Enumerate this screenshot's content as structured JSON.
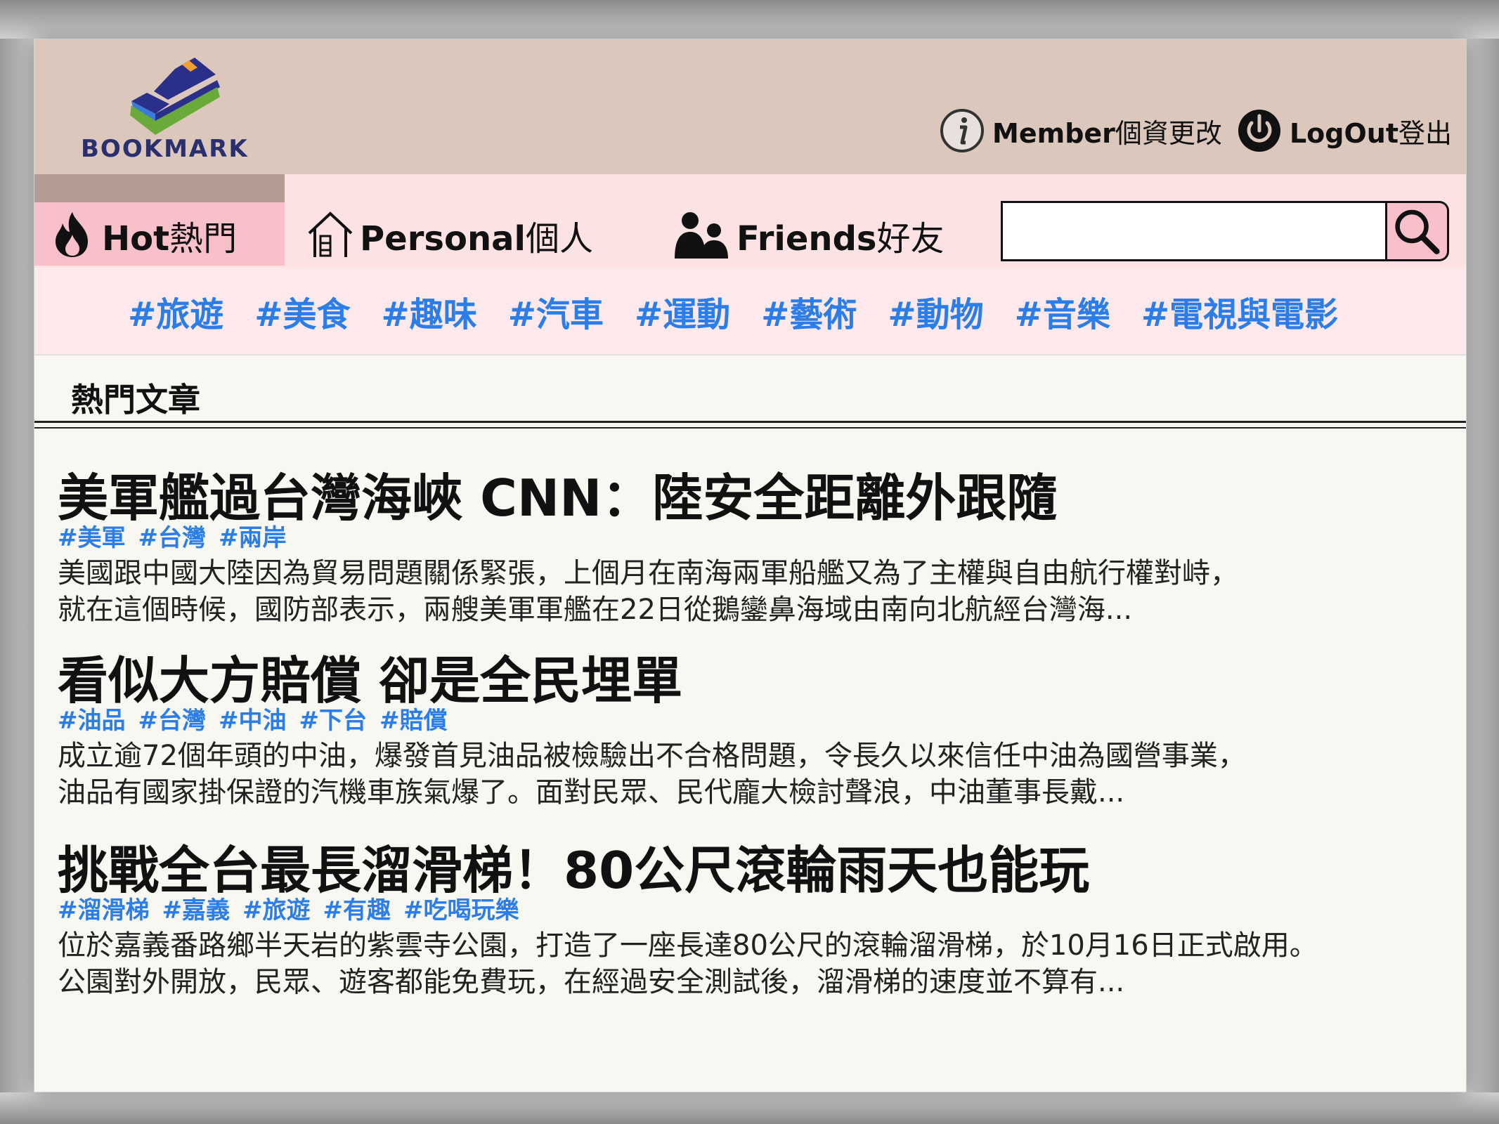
{
  "header": {
    "logo_text": "BOOKMARK",
    "member_en": "Member",
    "member_zh": "個資更改",
    "logout_en": "LogOut",
    "logout_zh": "登出"
  },
  "nav": {
    "tabs": [
      {
        "en": "Hot",
        "zh": "熱門",
        "icon": "flame-icon",
        "active": true
      },
      {
        "en": "Personal",
        "zh": "個人",
        "icon": "house-icon",
        "active": false
      },
      {
        "en": "Friends",
        "zh": "好友",
        "icon": "people-icon",
        "active": false
      }
    ],
    "search": {
      "value": "",
      "placeholder": ""
    }
  },
  "tags": [
    "#旅遊",
    "#美食",
    "#趣味",
    "#汽車",
    "#運動",
    "#藝術",
    "#動物",
    "#音樂",
    "#電視與電影"
  ],
  "section": {
    "title": "熱門文章"
  },
  "articles": [
    {
      "title": "美軍艦過台灣海峽 CNN：陸安全距離外跟隨",
      "tags": [
        "#美軍",
        "#台灣",
        "#兩岸"
      ],
      "summary_line1": "美國跟中國大陸因為貿易問題關係緊張，上個月在南海兩軍船艦又為了主權與自由航行權對峙，",
      "summary_line2": "就在這個時候，國防部表示，兩艘美軍軍艦在22日從鵝鑾鼻海域由南向北航經台灣海..."
    },
    {
      "title": "看似大方賠償 卻是全民埋單",
      "tags": [
        "#油品",
        "#台灣",
        "#中油",
        "#下台",
        "#賠償"
      ],
      "summary_line1": "成立逾72個年頭的中油，爆發首見油品被檢驗出不合格問題，令長久以來信任中油為國營事業，",
      "summary_line2": "油品有國家掛保證的汽機車族氣爆了。面對民眾、民代龐大檢討聲浪，中油董事長戴..."
    },
    {
      "title": "挑戰全台最長溜滑梯！80公尺滾輪雨天也能玩",
      "tags": [
        "#溜滑梯",
        "#嘉義",
        "#旅遊",
        "#有趣",
        "#吃喝玩樂"
      ],
      "summary_line1": "位於嘉義番路鄉半天岩的紫雲寺公園，打造了一座長達80公尺的滾輪溜滑梯，於10月16日正式啟用。",
      "summary_line2": "公園對外開放，民眾、遊客都能免費玩，在經過安全測試後，溜滑梯的速度並不算有..."
    }
  ],
  "colors": {
    "header_bg": "#dbc7bb",
    "nav_bg": "#fde2e4",
    "active_tab": "#f8c0c8",
    "tag_blue": "#2b7de9",
    "page_bg": "#f8f7f2"
  }
}
